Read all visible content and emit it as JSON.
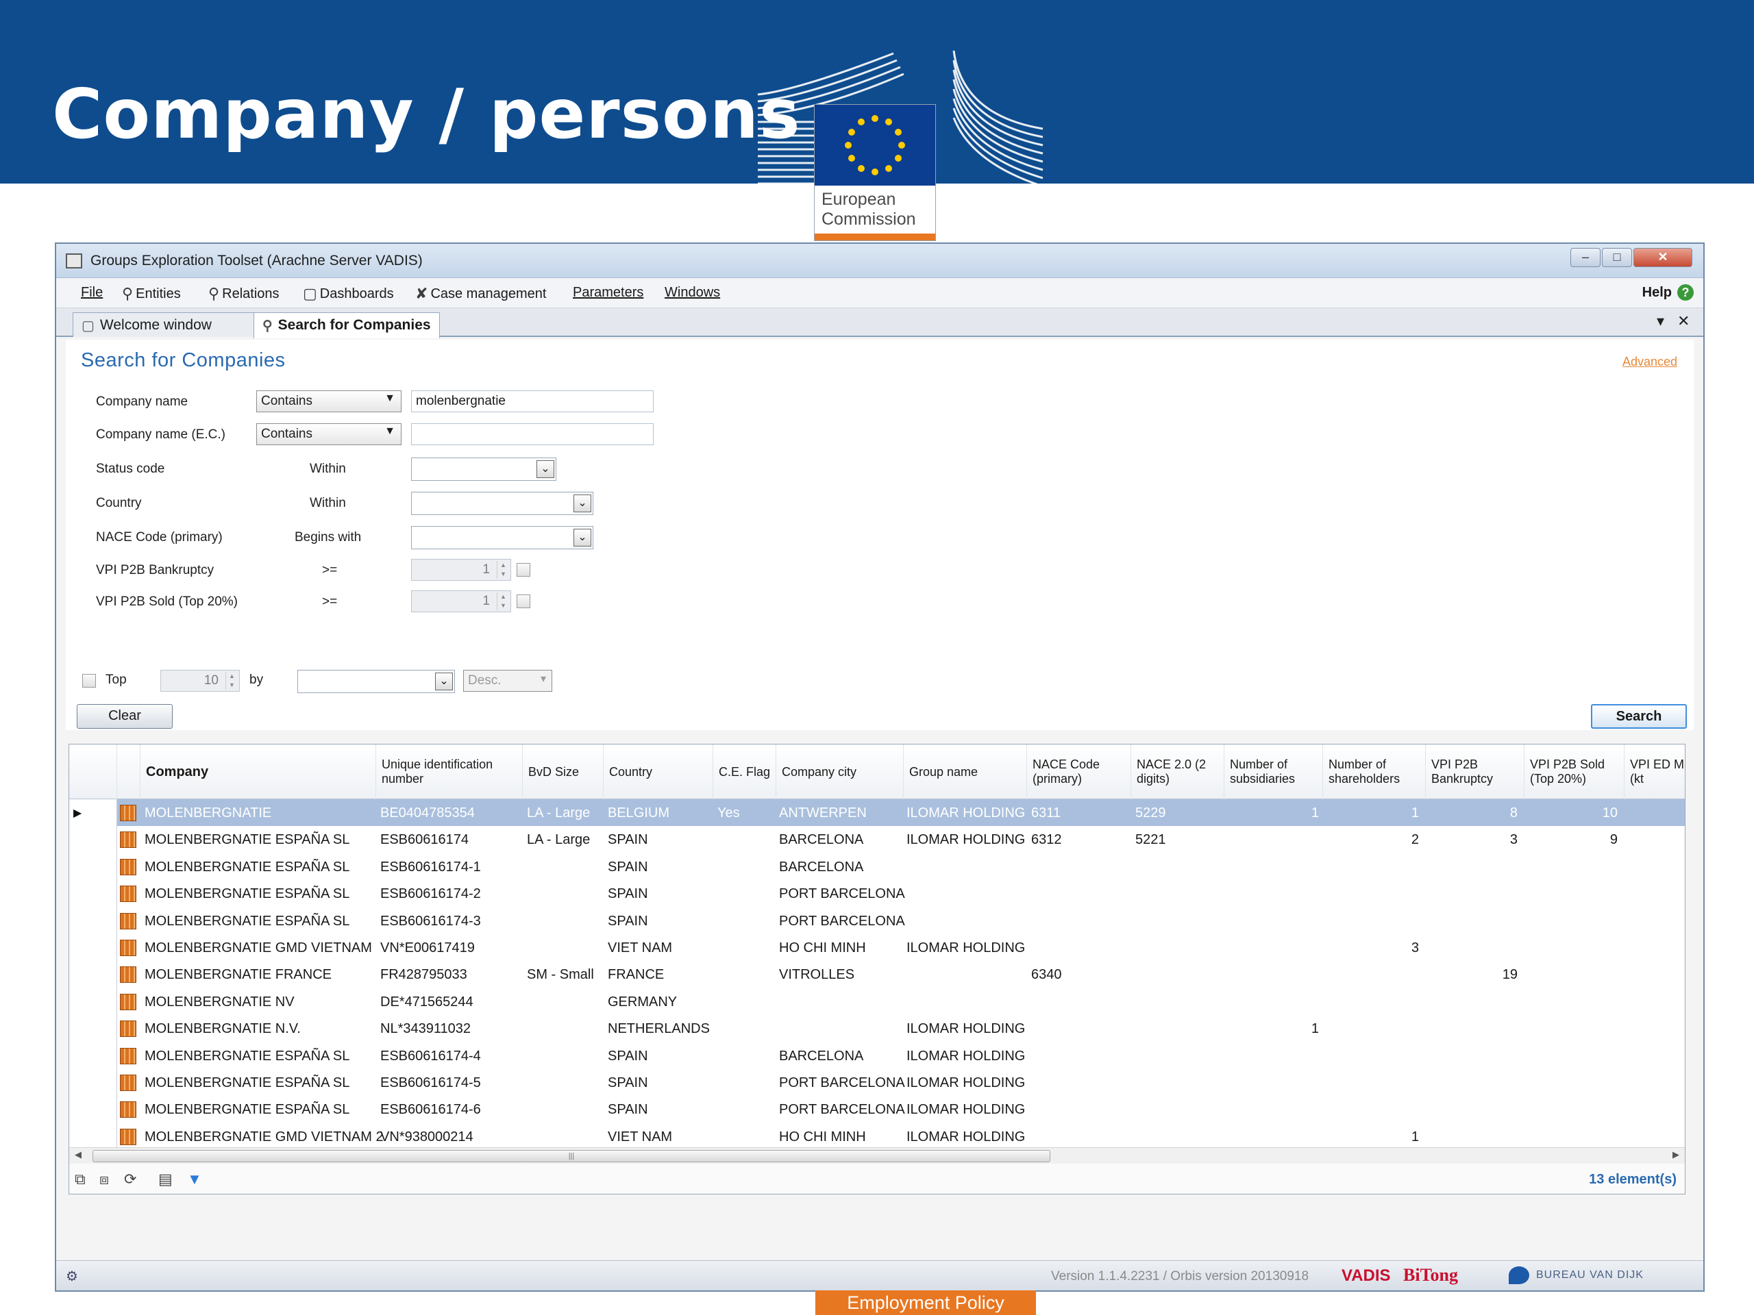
{
  "slide": {
    "title": "Company / persons",
    "logo_text_line1": "European",
    "logo_text_line2": "Commission",
    "footer_tag": "Employment Policy"
  },
  "window": {
    "title": "Groups Exploration Toolset (Arachne Server VADIS)",
    "minimize": "–",
    "maximize": "□",
    "close": "✕"
  },
  "menu": {
    "file": "File",
    "entities": "Entities",
    "relations": "Relations",
    "dashboards": "Dashboards",
    "case_management": "Case management",
    "parameters": "Parameters",
    "windows": "Windows",
    "help": "Help"
  },
  "tabs": [
    {
      "label": "Welcome window"
    },
    {
      "label": "Search for Companies"
    }
  ],
  "search": {
    "title": "Search for Companies",
    "advanced": "Advanced",
    "fields": {
      "company_name": "Company name",
      "company_name_ec": "Company name (E.C.)",
      "status_code": "Status code",
      "country": "Country",
      "nace": "NACE Code (primary)",
      "vpi_bankruptcy": "VPI P2B Bankruptcy",
      "vpi_sold": "VPI P2B Sold (Top 20%)"
    },
    "ops": {
      "contains_1": "Contains",
      "contains_2": "Contains",
      "within_1": "Within",
      "within_2": "Within",
      "begins_with": "Begins with",
      "gte_1": ">=",
      "gte_2": ">="
    },
    "values": {
      "company_name": "molenbergnatie",
      "company_name_ec": "",
      "vpi_bankruptcy": "1",
      "vpi_sold": "1"
    },
    "top_label": "Top",
    "top_value": "10",
    "by_label": "by",
    "order": "Desc.",
    "clear": "Clear",
    "search": "Search"
  },
  "grid": {
    "columns": [
      "Company",
      "Unique identification number",
      "BvD Size",
      "Country",
      "C.E. Flag",
      "Company city",
      "Group name",
      "NACE Code (primary)",
      "NACE 2.0 (2 digits)",
      "Number of subsidiaries",
      "Number of shareholders",
      "VPI P2B Bankruptcy",
      "VPI P2B Sold (Top 20%)",
      "VPI ED Min. (kt"
    ],
    "rows": [
      {
        "company": "MOLENBERGNATIE",
        "id": "BE0404785354",
        "size": "LA - Large",
        "country": "BELGIUM",
        "ce": "Yes",
        "city": "ANTWERPEN",
        "group": "ILOMAR HOLDING",
        "nace": "6311",
        "nace2": "5229",
        "subs": "1",
        "share": "1",
        "bank": "8",
        "sold": "10",
        "ed": ""
      },
      {
        "company": "MOLENBERGNATIE ESPAÑA SL",
        "id": "ESB60616174",
        "size": "LA - Large",
        "country": "SPAIN",
        "ce": "",
        "city": "BARCELONA",
        "group": "ILOMAR HOLDING",
        "nace": "6312",
        "nace2": "5221",
        "subs": "",
        "share": "2",
        "bank": "3",
        "sold": "9",
        "ed": ""
      },
      {
        "company": "MOLENBERGNATIE ESPAÑA SL",
        "id": "ESB60616174-1",
        "size": "",
        "country": "SPAIN",
        "ce": "",
        "city": "BARCELONA",
        "group": "",
        "nace": "",
        "nace2": "",
        "subs": "",
        "share": "",
        "bank": "",
        "sold": "",
        "ed": ""
      },
      {
        "company": "MOLENBERGNATIE ESPAÑA SL",
        "id": "ESB60616174-2",
        "size": "",
        "country": "SPAIN",
        "ce": "",
        "city": "PORT BARCELONA",
        "group": "",
        "nace": "",
        "nace2": "",
        "subs": "",
        "share": "",
        "bank": "",
        "sold": "",
        "ed": ""
      },
      {
        "company": "MOLENBERGNATIE ESPAÑA SL",
        "id": "ESB60616174-3",
        "size": "",
        "country": "SPAIN",
        "ce": "",
        "city": "PORT BARCELONA",
        "group": "",
        "nace": "",
        "nace2": "",
        "subs": "",
        "share": "",
        "bank": "",
        "sold": "",
        "ed": ""
      },
      {
        "company": "MOLENBERGNATIE GMD VIETNAM",
        "id": "VN*E00617419",
        "size": "",
        "country": "VIET NAM",
        "ce": "",
        "city": "HO CHI MINH",
        "group": "ILOMAR HOLDING",
        "nace": "",
        "nace2": "",
        "subs": "",
        "share": "3",
        "bank": "",
        "sold": "",
        "ed": ""
      },
      {
        "company": "MOLENBERGNATIE FRANCE",
        "id": "FR428795033",
        "size": "SM - Small",
        "country": "FRANCE",
        "ce": "",
        "city": "VITROLLES",
        "group": "",
        "nace": "6340",
        "nace2": "",
        "subs": "",
        "share": "",
        "bank": "19",
        "sold": "",
        "ed": ""
      },
      {
        "company": "MOLENBERGNATIE NV",
        "id": "DE*471565244",
        "size": "",
        "country": "GERMANY",
        "ce": "",
        "city": "",
        "group": "",
        "nace": "",
        "nace2": "",
        "subs": "",
        "share": "",
        "bank": "",
        "sold": "",
        "ed": ""
      },
      {
        "company": "MOLENBERGNATIE N.V.",
        "id": "NL*343911032",
        "size": "",
        "country": "NETHERLANDS",
        "ce": "",
        "city": "",
        "group": "ILOMAR HOLDING",
        "nace": "",
        "nace2": "",
        "subs": "1",
        "share": "",
        "bank": "",
        "sold": "",
        "ed": ""
      },
      {
        "company": "MOLENBERGNATIE ESPAÑA SL",
        "id": "ESB60616174-4",
        "size": "",
        "country": "SPAIN",
        "ce": "",
        "city": "BARCELONA",
        "group": "ILOMAR HOLDING",
        "nace": "",
        "nace2": "",
        "subs": "",
        "share": "",
        "bank": "",
        "sold": "",
        "ed": ""
      },
      {
        "company": "MOLENBERGNATIE ESPAÑA SL",
        "id": "ESB60616174-5",
        "size": "",
        "country": "SPAIN",
        "ce": "",
        "city": "PORT BARCELONA",
        "group": "ILOMAR HOLDING",
        "nace": "",
        "nace2": "",
        "subs": "",
        "share": "",
        "bank": "",
        "sold": "",
        "ed": ""
      },
      {
        "company": "MOLENBERGNATIE ESPAÑA SL",
        "id": "ESB60616174-6",
        "size": "",
        "country": "SPAIN",
        "ce": "",
        "city": "PORT BARCELONA",
        "group": "ILOMAR HOLDING",
        "nace": "",
        "nace2": "",
        "subs": "",
        "share": "",
        "bank": "",
        "sold": "",
        "ed": ""
      },
      {
        "company": "MOLENBERGNATIE GMD VIETNAM 2",
        "id": "VN*938000214",
        "size": "",
        "country": "VIET NAM",
        "ce": "",
        "city": "HO CHI MINH",
        "group": "ILOMAR HOLDING",
        "nace": "",
        "nace2": "",
        "subs": "",
        "share": "1",
        "bank": "",
        "sold": "",
        "ed": ""
      }
    ],
    "elements_count": "13 element(s)"
  },
  "status": {
    "version": "Version 1.1.4.2231 / Orbis version 20130918",
    "vadis": "VADIS",
    "bitong": "BiTong",
    "bvd": "BUREAU VAN DIJK"
  },
  "colors": {
    "header_blue": "#0e4c8e",
    "accent_orange": "#e87722",
    "selection": "#a9bfdd",
    "link_blue": "#2a6ab0"
  }
}
